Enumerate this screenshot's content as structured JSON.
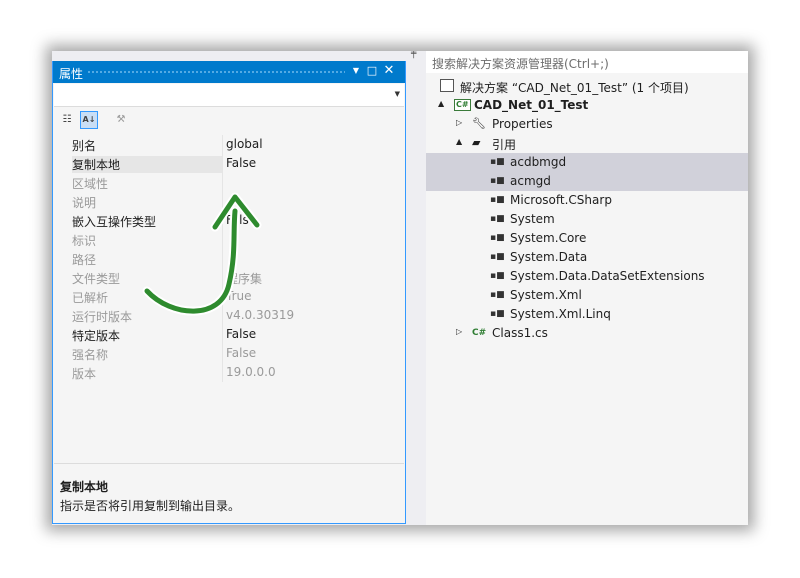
{
  "properties": {
    "title": "属性",
    "rows": [
      {
        "name": "别名",
        "value": "global",
        "readonly": false
      },
      {
        "name": "复制本地",
        "value": "False",
        "readonly": false
      },
      {
        "name": "区域性",
        "value": "",
        "readonly": true
      },
      {
        "name": "说明",
        "value": "",
        "readonly": true
      },
      {
        "name": "嵌入互操作类型",
        "value": "False",
        "readonly": false
      },
      {
        "name": "标识",
        "value": "",
        "readonly": true
      },
      {
        "name": "路径",
        "value": "",
        "readonly": true
      },
      {
        "name": "文件类型",
        "value": "程序集",
        "readonly": true
      },
      {
        "name": "已解析",
        "value": "True",
        "readonly": true
      },
      {
        "name": "运行时版本",
        "value": "v4.0.30319",
        "readonly": true
      },
      {
        "name": "特定版本",
        "value": "False",
        "readonly": false
      },
      {
        "name": "强名称",
        "value": "False",
        "readonly": true
      },
      {
        "name": "版本",
        "value": "19.0.0.0",
        "readonly": true
      }
    ],
    "description_title": "复制本地",
    "description_text": "指示是否将引用复制到输出目录。",
    "accent_color": "#007acc"
  },
  "solution_explorer": {
    "search_placeholder": "搜索解决方案资源管理器(Ctrl+;)",
    "nodes": [
      {
        "label": "解决方案 “CAD_Net_01_Test” (1 个项目)",
        "icon": "solution-icon",
        "indent": 0,
        "expand": "",
        "bold": false,
        "highlight": false
      },
      {
        "label": "CAD_Net_01_Test",
        "icon": "csharp-project-icon",
        "indent": 1,
        "expand": "▲",
        "bold": true,
        "highlight": false
      },
      {
        "label": "Properties",
        "icon": "wrench-icon",
        "indent": 2,
        "expand": "▷",
        "bold": false,
        "highlight": false
      },
      {
        "label": "引用",
        "icon": "references-folder-icon",
        "indent": 2,
        "expand": "▲",
        "bold": false,
        "highlight": false
      },
      {
        "label": "acdbmgd",
        "icon": "reference-icon",
        "indent": 3,
        "expand": "",
        "bold": false,
        "highlight": true
      },
      {
        "label": "acmgd",
        "icon": "reference-icon",
        "indent": 3,
        "expand": "",
        "bold": false,
        "highlight": true
      },
      {
        "label": "Microsoft.CSharp",
        "icon": "reference-icon",
        "indent": 3,
        "expand": "",
        "bold": false,
        "highlight": false
      },
      {
        "label": "System",
        "icon": "reference-icon",
        "indent": 3,
        "expand": "",
        "bold": false,
        "highlight": false
      },
      {
        "label": "System.Core",
        "icon": "reference-icon",
        "indent": 3,
        "expand": "",
        "bold": false,
        "highlight": false
      },
      {
        "label": "System.Data",
        "icon": "reference-icon",
        "indent": 3,
        "expand": "",
        "bold": false,
        "highlight": false
      },
      {
        "label": "System.Data.DataSetExtensions",
        "icon": "reference-icon",
        "indent": 3,
        "expand": "",
        "bold": false,
        "highlight": false
      },
      {
        "label": "System.Xml",
        "icon": "reference-icon",
        "indent": 3,
        "expand": "",
        "bold": false,
        "highlight": false
      },
      {
        "label": "System.Xml.Linq",
        "icon": "reference-icon",
        "indent": 3,
        "expand": "",
        "bold": false,
        "highlight": false
      },
      {
        "label": "Class1.cs",
        "icon": "csharp-file-icon",
        "indent": 2,
        "expand": "▷",
        "bold": false,
        "highlight": false
      }
    ]
  },
  "annotation": {
    "arrow_color": "#2e8b2e"
  }
}
